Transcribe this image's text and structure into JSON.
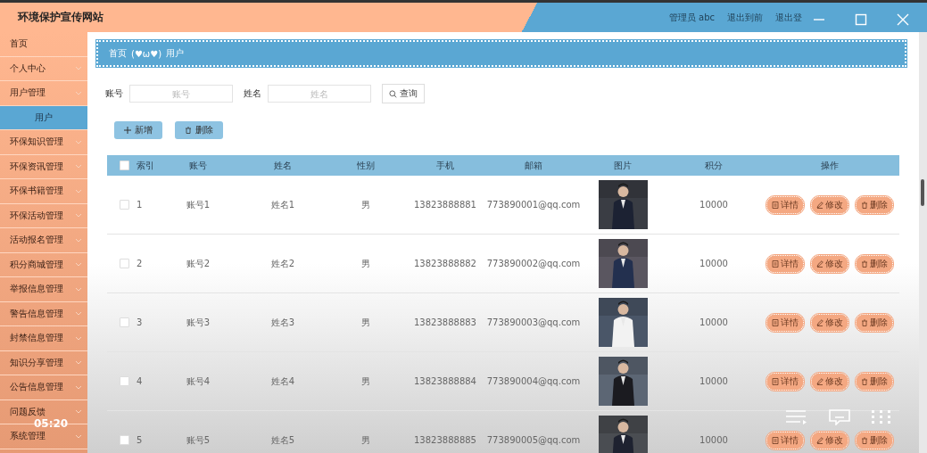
{
  "header": {
    "title": "环境保护宣传网站",
    "user": "管理员 abc",
    "links": [
      "退出到前",
      "退出登"
    ]
  },
  "sidebar": {
    "items": [
      {
        "label": "首页",
        "expandable": false,
        "selected": false
      },
      {
        "label": "个人中心",
        "expandable": true,
        "selected": false
      },
      {
        "label": "用户管理",
        "expandable": true,
        "selected": false,
        "children": [
          {
            "label": "用户",
            "selected": true
          }
        ]
      },
      {
        "label": "环保知识管理",
        "expandable": true,
        "selected": false
      },
      {
        "label": "环保资讯管理",
        "expandable": true,
        "selected": false
      },
      {
        "label": "环保书籍管理",
        "expandable": true,
        "selected": false
      },
      {
        "label": "环保活动管理",
        "expandable": true,
        "selected": false
      },
      {
        "label": "活动报名管理",
        "expandable": true,
        "selected": false
      },
      {
        "label": "积分商城管理",
        "expandable": true,
        "selected": false
      },
      {
        "label": "举报信息管理",
        "expandable": true,
        "selected": false
      },
      {
        "label": "警告信息管理",
        "expandable": true,
        "selected": false
      },
      {
        "label": "封禁信息管理",
        "expandable": true,
        "selected": false
      },
      {
        "label": "知识分享管理",
        "expandable": true,
        "selected": false
      },
      {
        "label": "公告信息管理",
        "expandable": true,
        "selected": false
      },
      {
        "label": "问题反馈",
        "expandable": true,
        "selected": false
      },
      {
        "label": "系统管理",
        "expandable": true,
        "selected": false
      }
    ]
  },
  "breadcrumb": {
    "items": [
      "首页",
      "用户"
    ],
    "separator": "(♥ω♥)"
  },
  "search": {
    "fields": [
      {
        "label": "账号",
        "placeholder": "账号"
      },
      {
        "label": "姓名",
        "placeholder": "姓名"
      }
    ],
    "button": "查询"
  },
  "actions": {
    "add": "新增",
    "delete": "删除"
  },
  "table": {
    "columns": [
      "索引",
      "账号",
      "姓名",
      "性别",
      "手机",
      "邮箱",
      "图片",
      "积分",
      "操作"
    ],
    "select_all_checked": false,
    "rows": [
      {
        "index": "1",
        "account": "账号1",
        "name": "姓名1",
        "gender": "男",
        "phone": "13823888881",
        "email": "773890001@qq.com",
        "points": "10000",
        "checked": false,
        "buttons": [
          "详情",
          "修改",
          "删除"
        ]
      },
      {
        "index": "2",
        "account": "账号2",
        "name": "姓名2",
        "gender": "男",
        "phone": "13823888882",
        "email": "773890002@qq.com",
        "points": "10000",
        "checked": false,
        "buttons": [
          "详情",
          "修改",
          "删除"
        ]
      },
      {
        "index": "3",
        "account": "账号3",
        "name": "姓名3",
        "gender": "男",
        "phone": "13823888883",
        "email": "773890003@qq.com",
        "points": "10000",
        "checked": false,
        "buttons": [
          "详情",
          "修改",
          "删除"
        ]
      },
      {
        "index": "4",
        "account": "账号4",
        "name": "姓名4",
        "gender": "男",
        "phone": "13823888884",
        "email": "773890004@qq.com",
        "points": "10000",
        "checked": false,
        "buttons": [
          "详情",
          "修改",
          "删除"
        ]
      },
      {
        "index": "5",
        "account": "账号5",
        "name": "姓名5",
        "gender": "男",
        "phone": "13823888885",
        "email": "773890005@qq.com",
        "points": "10000",
        "checked": false,
        "buttons": [
          "详情",
          "修改",
          "删除"
        ]
      }
    ]
  },
  "video_overlay": {
    "time": "05:20"
  }
}
